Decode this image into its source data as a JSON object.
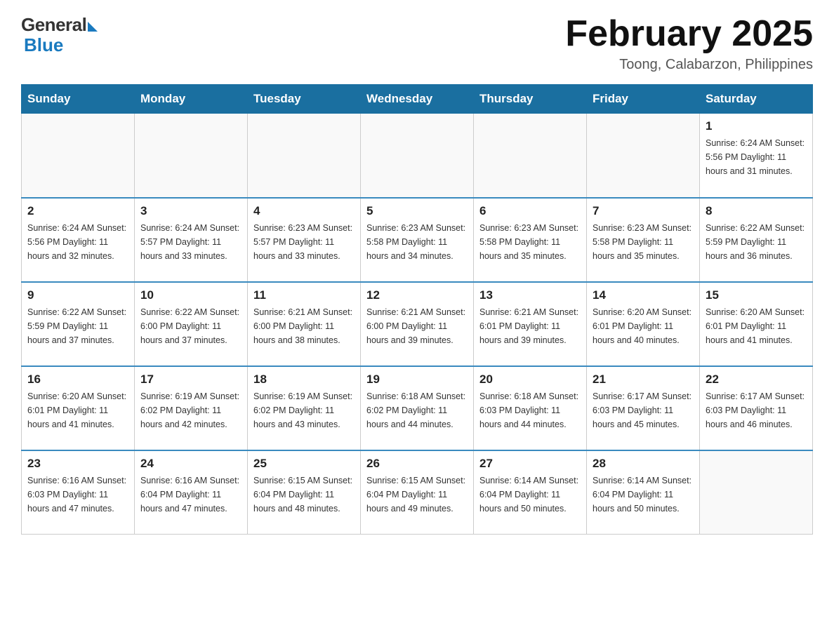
{
  "header": {
    "logo_general": "General",
    "logo_blue": "Blue",
    "title": "February 2025",
    "subtitle": "Toong, Calabarzon, Philippines"
  },
  "days_of_week": [
    "Sunday",
    "Monday",
    "Tuesday",
    "Wednesday",
    "Thursday",
    "Friday",
    "Saturday"
  ],
  "weeks": [
    [
      {
        "day": "",
        "info": ""
      },
      {
        "day": "",
        "info": ""
      },
      {
        "day": "",
        "info": ""
      },
      {
        "day": "",
        "info": ""
      },
      {
        "day": "",
        "info": ""
      },
      {
        "day": "",
        "info": ""
      },
      {
        "day": "1",
        "info": "Sunrise: 6:24 AM\nSunset: 5:56 PM\nDaylight: 11 hours\nand 31 minutes."
      }
    ],
    [
      {
        "day": "2",
        "info": "Sunrise: 6:24 AM\nSunset: 5:56 PM\nDaylight: 11 hours\nand 32 minutes."
      },
      {
        "day": "3",
        "info": "Sunrise: 6:24 AM\nSunset: 5:57 PM\nDaylight: 11 hours\nand 33 minutes."
      },
      {
        "day": "4",
        "info": "Sunrise: 6:23 AM\nSunset: 5:57 PM\nDaylight: 11 hours\nand 33 minutes."
      },
      {
        "day": "5",
        "info": "Sunrise: 6:23 AM\nSunset: 5:58 PM\nDaylight: 11 hours\nand 34 minutes."
      },
      {
        "day": "6",
        "info": "Sunrise: 6:23 AM\nSunset: 5:58 PM\nDaylight: 11 hours\nand 35 minutes."
      },
      {
        "day": "7",
        "info": "Sunrise: 6:23 AM\nSunset: 5:58 PM\nDaylight: 11 hours\nand 35 minutes."
      },
      {
        "day": "8",
        "info": "Sunrise: 6:22 AM\nSunset: 5:59 PM\nDaylight: 11 hours\nand 36 minutes."
      }
    ],
    [
      {
        "day": "9",
        "info": "Sunrise: 6:22 AM\nSunset: 5:59 PM\nDaylight: 11 hours\nand 37 minutes."
      },
      {
        "day": "10",
        "info": "Sunrise: 6:22 AM\nSunset: 6:00 PM\nDaylight: 11 hours\nand 37 minutes."
      },
      {
        "day": "11",
        "info": "Sunrise: 6:21 AM\nSunset: 6:00 PM\nDaylight: 11 hours\nand 38 minutes."
      },
      {
        "day": "12",
        "info": "Sunrise: 6:21 AM\nSunset: 6:00 PM\nDaylight: 11 hours\nand 39 minutes."
      },
      {
        "day": "13",
        "info": "Sunrise: 6:21 AM\nSunset: 6:01 PM\nDaylight: 11 hours\nand 39 minutes."
      },
      {
        "day": "14",
        "info": "Sunrise: 6:20 AM\nSunset: 6:01 PM\nDaylight: 11 hours\nand 40 minutes."
      },
      {
        "day": "15",
        "info": "Sunrise: 6:20 AM\nSunset: 6:01 PM\nDaylight: 11 hours\nand 41 minutes."
      }
    ],
    [
      {
        "day": "16",
        "info": "Sunrise: 6:20 AM\nSunset: 6:01 PM\nDaylight: 11 hours\nand 41 minutes."
      },
      {
        "day": "17",
        "info": "Sunrise: 6:19 AM\nSunset: 6:02 PM\nDaylight: 11 hours\nand 42 minutes."
      },
      {
        "day": "18",
        "info": "Sunrise: 6:19 AM\nSunset: 6:02 PM\nDaylight: 11 hours\nand 43 minutes."
      },
      {
        "day": "19",
        "info": "Sunrise: 6:18 AM\nSunset: 6:02 PM\nDaylight: 11 hours\nand 44 minutes."
      },
      {
        "day": "20",
        "info": "Sunrise: 6:18 AM\nSunset: 6:03 PM\nDaylight: 11 hours\nand 44 minutes."
      },
      {
        "day": "21",
        "info": "Sunrise: 6:17 AM\nSunset: 6:03 PM\nDaylight: 11 hours\nand 45 minutes."
      },
      {
        "day": "22",
        "info": "Sunrise: 6:17 AM\nSunset: 6:03 PM\nDaylight: 11 hours\nand 46 minutes."
      }
    ],
    [
      {
        "day": "23",
        "info": "Sunrise: 6:16 AM\nSunset: 6:03 PM\nDaylight: 11 hours\nand 47 minutes."
      },
      {
        "day": "24",
        "info": "Sunrise: 6:16 AM\nSunset: 6:04 PM\nDaylight: 11 hours\nand 47 minutes."
      },
      {
        "day": "25",
        "info": "Sunrise: 6:15 AM\nSunset: 6:04 PM\nDaylight: 11 hours\nand 48 minutes."
      },
      {
        "day": "26",
        "info": "Sunrise: 6:15 AM\nSunset: 6:04 PM\nDaylight: 11 hours\nand 49 minutes."
      },
      {
        "day": "27",
        "info": "Sunrise: 6:14 AM\nSunset: 6:04 PM\nDaylight: 11 hours\nand 50 minutes."
      },
      {
        "day": "28",
        "info": "Sunrise: 6:14 AM\nSunset: 6:04 PM\nDaylight: 11 hours\nand 50 minutes."
      },
      {
        "day": "",
        "info": ""
      }
    ]
  ]
}
